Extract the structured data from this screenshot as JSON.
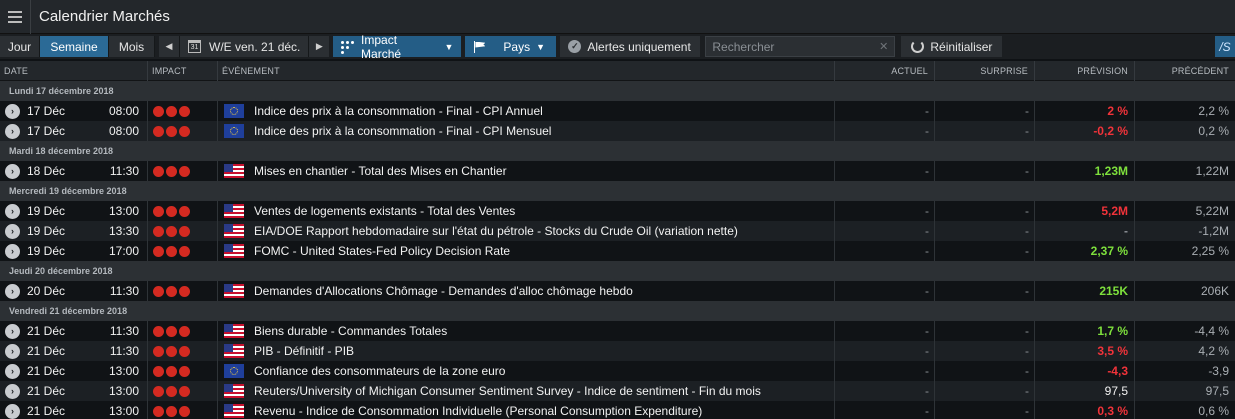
{
  "window": {
    "title": "Calendrier Marchés"
  },
  "toolbar": {
    "views": [
      {
        "label": "Jour",
        "active": false
      },
      {
        "label": "Semaine",
        "active": true
      },
      {
        "label": "Mois",
        "active": false
      }
    ],
    "prev_icon": "triangle-left-icon",
    "next_icon": "triangle-right-icon",
    "calendar_day": "31",
    "date_label": "W/E ven. 21 déc.",
    "impact_label": "Impact Marché",
    "country_label": "Pays",
    "alerts_label": "Alertes uniquement",
    "search_placeholder": "Rechercher",
    "reset_label": "Réinitialiser",
    "end_label": "/S",
    "accent_color": "#245d86"
  },
  "columns": {
    "date": "DATE",
    "impact": "IMPACT",
    "event": "ÉVÉNEMENT",
    "actual": "ACTUEL",
    "surprise": "SURPRISE",
    "forecast": "PRÉVISION",
    "previous": "PRÉCÉDENT"
  },
  "groups": [
    {
      "label": "Lundi 17 décembre 2018",
      "rows": [
        {
          "day": "17 Déc",
          "time": "08:00",
          "flag": "eu",
          "event": "Indice des prix à la consommation - Final - CPI Annuel",
          "actual": "-",
          "surprise": "-",
          "forecast": "2 %",
          "forecast_color": "red",
          "previous": "2,2 %"
        },
        {
          "day": "17 Déc",
          "time": "08:00",
          "flag": "eu",
          "event": "Indice des prix à la consommation - Final - CPI Mensuel",
          "actual": "-",
          "surprise": "-",
          "forecast": "-0,2 %",
          "forecast_color": "red",
          "previous": "0,2 %"
        }
      ]
    },
    {
      "label": "Mardi 18 décembre 2018",
      "rows": [
        {
          "day": "18 Déc",
          "time": "11:30",
          "flag": "us",
          "event": "Mises en chantier - Total des Mises en Chantier",
          "actual": "-",
          "surprise": "-",
          "forecast": "1,23M",
          "forecast_color": "green",
          "previous": "1,22M"
        }
      ]
    },
    {
      "label": "Mercredi 19 décembre 2018",
      "rows": [
        {
          "day": "19 Déc",
          "time": "13:00",
          "flag": "us",
          "event": "Ventes de logements existants - Total des Ventes",
          "actual": "-",
          "surprise": "-",
          "forecast": "5,2M",
          "forecast_color": "red",
          "previous": "5,22M"
        },
        {
          "day": "19 Déc",
          "time": "13:30",
          "flag": "us",
          "event": "EIA/DOE Rapport hebdomadaire sur l'état du pétrole - Stocks du Crude Oil (variation nette)",
          "actual": "-",
          "surprise": "-",
          "forecast": "-",
          "forecast_color": "dim",
          "previous": "-1,2M"
        },
        {
          "day": "19 Déc",
          "time": "17:00",
          "flag": "us",
          "event": "FOMC - United States-Fed Policy Decision Rate",
          "actual": "-",
          "surprise": "-",
          "forecast": "2,37 %",
          "forecast_color": "green",
          "previous": "2,25 %"
        }
      ]
    },
    {
      "label": "Jeudi 20 décembre 2018",
      "rows": [
        {
          "day": "20 Déc",
          "time": "11:30",
          "flag": "us",
          "event": "Demandes d'Allocations Chômage - Demandes d'alloc chômage hebdo",
          "actual": "-",
          "surprise": "-",
          "forecast": "215K",
          "forecast_color": "green",
          "previous": "206K"
        }
      ]
    },
    {
      "label": "Vendredi 21 décembre 2018",
      "rows": [
        {
          "day": "21 Déc",
          "time": "11:30",
          "flag": "us",
          "event": "Biens durable - Commandes Totales",
          "actual": "-",
          "surprise": "-",
          "forecast": "1,7 %",
          "forecast_color": "green",
          "previous": "-4,4 %"
        },
        {
          "day": "21 Déc",
          "time": "11:30",
          "flag": "us",
          "event": "PIB - Définitif - PIB",
          "actual": "-",
          "surprise": "-",
          "forecast": "3,5 %",
          "forecast_color": "red",
          "previous": "4,2 %"
        },
        {
          "day": "21 Déc",
          "time": "13:00",
          "flag": "eu",
          "event": "Confiance des consommateurs de la zone euro",
          "actual": "-",
          "surprise": "-",
          "forecast": "-4,3",
          "forecast_color": "red",
          "previous": "-3,9"
        },
        {
          "day": "21 Déc",
          "time": "13:00",
          "flag": "us",
          "event": "Reuters/University of Michigan Consumer Sentiment Survey - Indice de sentiment - Fin du mois",
          "actual": "-",
          "surprise": "-",
          "forecast": "97,5",
          "forecast_color": "white",
          "previous": "97,5"
        },
        {
          "day": "21 Déc",
          "time": "13:00",
          "flag": "us",
          "event": "Revenu - Indice de Consommation Individuelle (Personal Consumption Expenditure)",
          "actual": "-",
          "surprise": "-",
          "forecast": "0,3 %",
          "forecast_color": "red",
          "previous": "0,6 %"
        }
      ]
    }
  ],
  "impact_level": 3,
  "colors": {
    "impact_dot": "#d42a21",
    "forecast_red": "#f2333a",
    "forecast_green": "#7ee03c"
  }
}
